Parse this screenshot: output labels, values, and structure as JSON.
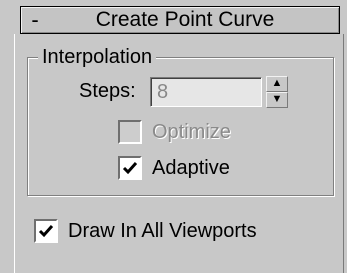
{
  "rollout": {
    "title": "Create Point Curve",
    "collapse_glyph": "-"
  },
  "interpolation": {
    "group_label": "Interpolation",
    "steps_label": "Steps:",
    "steps_value": "8",
    "steps_enabled": false,
    "optimize": {
      "label": "Optimize",
      "checked": false,
      "enabled": false
    },
    "adaptive": {
      "label": "Adaptive",
      "checked": true,
      "enabled": true
    }
  },
  "draw_in_all_viewports": {
    "label": "Draw In All Viewports",
    "checked": true,
    "enabled": true
  },
  "icons": {
    "spinner_up": "spinner-up-icon",
    "spinner_down": "spinner-down-icon",
    "checkmark": "checkmark-icon"
  },
  "colors": {
    "panel_bg": "#c8c8c8",
    "disabled_text": "#8a8a8a"
  }
}
